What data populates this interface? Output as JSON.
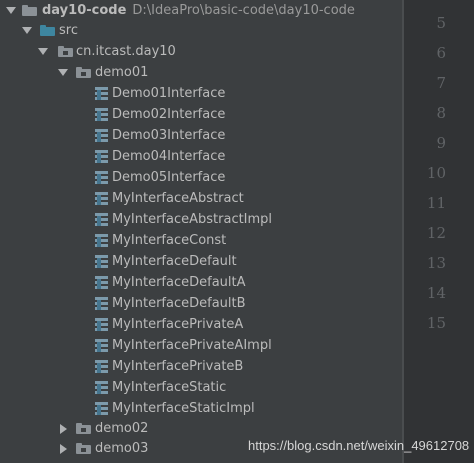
{
  "project": {
    "name": "day10-code",
    "path": "D:\\IdeaPro\\basic-code\\day10-code"
  },
  "tree": {
    "src_label": "src",
    "package_label": "cn.itcast.day10",
    "demo01_label": "demo01",
    "demo01_items": [
      "Demo01Interface",
      "Demo02Interface",
      "Demo03Interface",
      "Demo04Interface",
      "Demo05Interface",
      "MyInterfaceAbstract",
      "MyInterfaceAbstractImpl",
      "MyInterfaceConst",
      "MyInterfaceDefault",
      "MyInterfaceDefaultA",
      "MyInterfaceDefaultB",
      "MyInterfacePrivateA",
      "MyInterfacePrivateAImpl",
      "MyInterfacePrivateB",
      "MyInterfaceStatic",
      "MyInterfaceStaticImpl"
    ],
    "demo02_label": "demo02",
    "demo03_label": "demo03"
  },
  "gutter": {
    "line_numbers": [
      "5",
      "6",
      "7",
      "8",
      "9",
      "10",
      "11",
      "12",
      "13",
      "14",
      "15"
    ]
  },
  "icons": {
    "expanded": "chevron-down-icon",
    "collapsed": "chevron-right-icon",
    "module": "module-folder-icon",
    "source_root": "source-folder-icon",
    "package": "package-icon",
    "interface": "interface-icon"
  },
  "colors": {
    "panel_bg": "#3c3f41",
    "gutter_bg": "#313335",
    "text": "#bbbbbb",
    "line_number": "#606366",
    "source_folder": "#3e86a0",
    "interface_icon": "#7c9aab"
  },
  "watermark": "https://blog.csdn.net/weixin_49612708"
}
